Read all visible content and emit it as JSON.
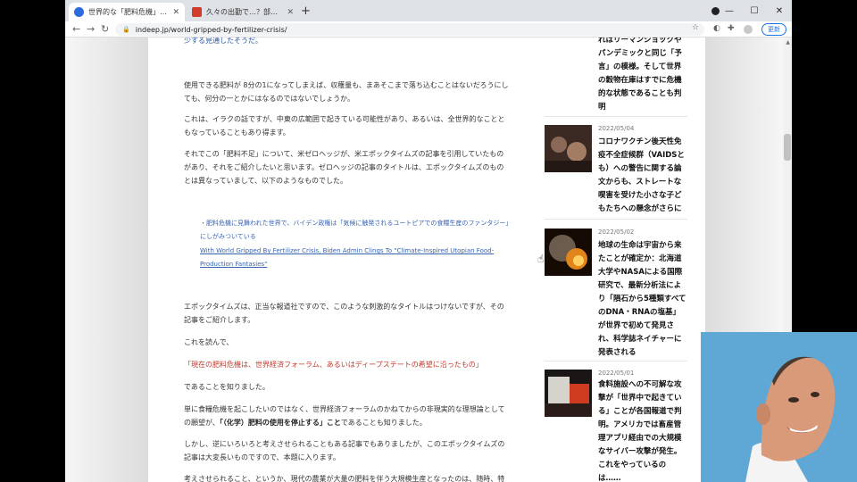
{
  "browser": {
    "tabs": [
      {
        "title": "世界的な「肥料危機」で世界経済",
        "active": true
      },
      {
        "title": "久々の出勤で…？部の通勤電車が",
        "active": false
      }
    ],
    "url": "indeep.jp/world-gripped-by-fertilizer-crisis/",
    "update_label": "更新"
  },
  "article": {
    "paragraphs": [
      {
        "id": "p0",
        "text": "少する見通したそうだ。"
      },
      {
        "id": "p1",
        "text": "使用できる肥料が 8分の1になってしまえば、収穫量も、まあそこまで落ち込むことはないだろうにしても、何分の一とかにはなるのではないでしょうか。"
      },
      {
        "id": "p2",
        "text": "これは、イラクの話ですが、中東の広範囲で起きている可能性があり、あるいは、全世界的なことともなっていることもあり得ます。"
      },
      {
        "id": "p3",
        "text": "それでこの「肥料不足」について、米ゼロヘッジが、米エポックタイムズの記事を引用していたものがあり、それをご紹介したいと思います。ゼロヘッジの記事のタイトルは、エポックタイムズのものとは異なっていまして、以下のようなものでした。"
      },
      {
        "id": "q1",
        "text": "・肥料危機に見舞われた世界で、バイデン政権は「気候に触発されるユートピアでの食糧生産のファンタジー」にしがみついている"
      },
      {
        "id": "q2",
        "text": "With World Gripped By Fertilizer Crisis, Biden Admin Clings To \"Climate-Inspired Utopian Food-Production Fantasies\""
      },
      {
        "id": "p4",
        "text": "エポックタイムズは、正当な報道社ですので、このような刺激的なタイトルはつけないですが、その記事をご紹介します。"
      },
      {
        "id": "p5",
        "text": "これを読んで、"
      },
      {
        "id": "p6",
        "text": "「現在の肥料危機は、世界経済フォーラム、あるいはディープステートの希望に沿ったもの」"
      },
      {
        "id": "p7",
        "text": "であることを知りました。"
      },
      {
        "id": "p8a",
        "text": "単に食糧危機を起こしたいのではなく、世界経済フォーラムのかねてからの非現実的な理想論としての願望が、"
      },
      {
        "id": "p8b",
        "text": "「（化学）肥料の使用を停止する」こと"
      },
      {
        "id": "p8c",
        "text": "であることも知りました。"
      },
      {
        "id": "p9",
        "text": "しかし、逆にいろいろと考えさせられることもある記事でもありましたが、このエポックタイムズの記事は大変長いものですので、本題に入ります。"
      },
      {
        "id": "p10",
        "text": "考えさせられること、というか、現代の農業が大量の肥料を伴う大規模生産となったのは、随時、特に"
      }
    ]
  },
  "sidebar": {
    "items": [
      {
        "date": "",
        "text": "れはリーマンショックやパンデミックと同じ「予言」の模様。そして世界の穀物在庫はすでに危機的な状態であることも判明"
      },
      {
        "date": "2022/05/04",
        "text": "コロナワクチン後天性免疫不全症候群（VAIDSとも）への警告に関する論文からも、ストレートな喫害を受けた小さな子どもたちへの懸念がさらに"
      },
      {
        "date": "2022/05/02",
        "text": "地球の生命は宇宙から来たことが確定か：北海道大学やNASAによる国際研究で、最新分析法により「隕石から5種類すべてのDNA・RNAの塩基」が世界で初めて発見され、科学誌ネイチャーに発表される"
      },
      {
        "date": "2022/05/01",
        "text": "食料施設への不可解な攻撃が「世界中で起きている」ことが各国報道で判明。アメリカでは畜産管理アプリ経由での大規模なサイバー攻撃が発生。これをやっているのは……"
      }
    ]
  },
  "colors": {
    "link": "#2b55a0",
    "highlight_red": "#c0392b",
    "update_blue": "#1a73e8",
    "webcam_bg": "#5fa8d6"
  },
  "icons": [
    "back-arrow-icon",
    "forward-arrow-icon",
    "reload-icon",
    "lock-icon",
    "star-icon",
    "puzzle-icon",
    "minimize-icon",
    "maximize-icon",
    "close-icon",
    "plus-icon",
    "cursor-icon"
  ]
}
